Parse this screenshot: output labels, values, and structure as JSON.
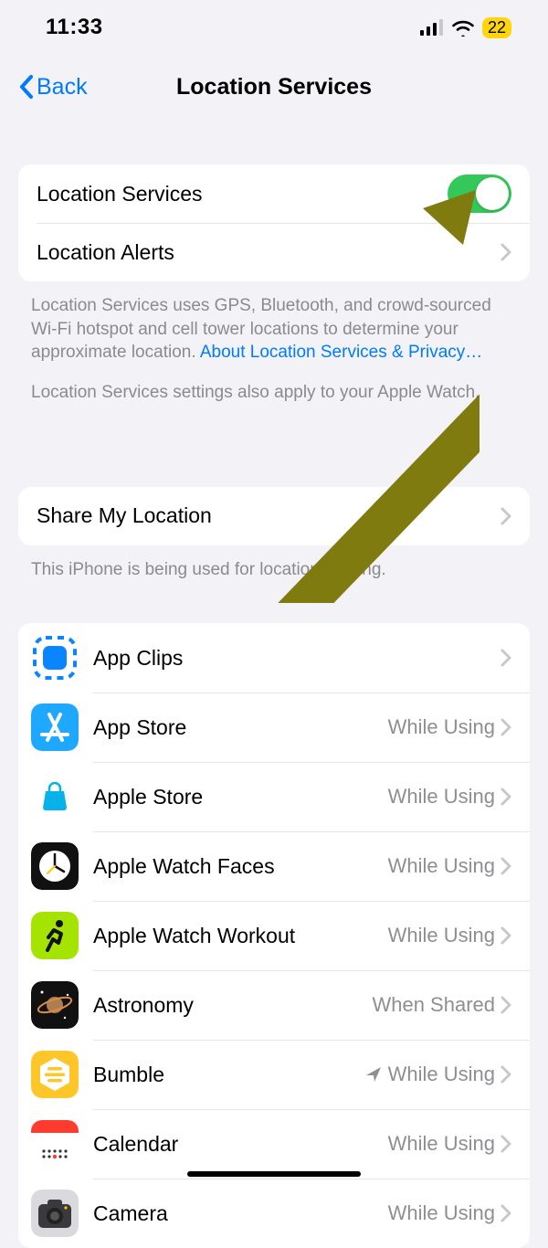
{
  "status": {
    "time": "11:33",
    "battery": "22"
  },
  "nav": {
    "back": "Back",
    "title": "Location Services"
  },
  "main_group": {
    "location_services_label": "Location Services",
    "location_services_on": true,
    "location_alerts_label": "Location Alerts"
  },
  "footer1_pre": "Location Services uses GPS, Bluetooth, and crowd-sourced Wi-Fi hotspot and cell tower locations to determine your approximate location. ",
  "footer1_link": "About Location Services & Privacy…",
  "footer2": "Location Services settings also apply to your Apple Watch.",
  "share_group": {
    "label": "Share My Location"
  },
  "share_footer": "This iPhone is being used for location sharing.",
  "apps": [
    {
      "name": "App Clips",
      "status": "",
      "icon": "appclips"
    },
    {
      "name": "App Store",
      "status": "While Using",
      "icon": "appstore"
    },
    {
      "name": "Apple Store",
      "status": "While Using",
      "icon": "applestore"
    },
    {
      "name": "Apple Watch Faces",
      "status": "While Using",
      "icon": "watchfaces"
    },
    {
      "name": "Apple Watch Workout",
      "status": "While Using",
      "icon": "workout"
    },
    {
      "name": "Astronomy",
      "status": "When Shared",
      "icon": "astronomy"
    },
    {
      "name": "Bumble",
      "status": "While Using",
      "icon": "bumble",
      "indicator": true
    },
    {
      "name": "Calendar",
      "status": "While Using",
      "icon": "calendar"
    },
    {
      "name": "Camera",
      "status": "While Using",
      "icon": "camera"
    }
  ]
}
